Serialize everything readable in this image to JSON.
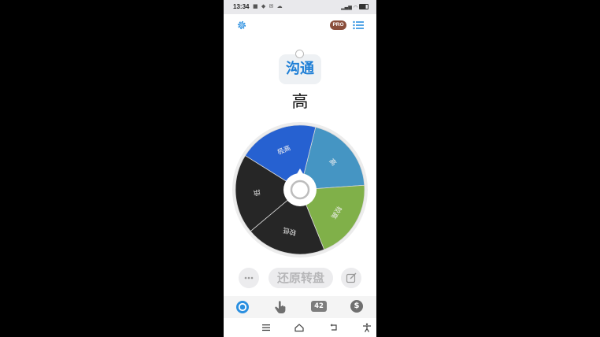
{
  "status_bar": {
    "time": "13:34",
    "notification_icons": [
      "video-icon",
      "message-icon",
      "mail-icon",
      "cloud-icon"
    ],
    "right_icons": [
      "network-speed-icon",
      "signal-icon",
      "wifi-icon",
      "battery-icon"
    ]
  },
  "header": {
    "settings_icon": "gear-icon",
    "pro_badge": "PRO",
    "list_icon": "list-icon"
  },
  "result": {
    "title": "沟通",
    "value": "高"
  },
  "wheel": {
    "segments": [
      {
        "label": "高",
        "color": "#4595c3"
      },
      {
        "label": "较高",
        "color": "#80b049"
      },
      {
        "label": "较低",
        "color": "#262626"
      },
      {
        "label": "低",
        "color": "#262626"
      },
      {
        "label": "极高",
        "color": "#2661d1"
      }
    ],
    "center_button": "spin-button"
  },
  "bottom_controls": {
    "more_icon": "more-icon",
    "reset_label": "还原转盘",
    "edit_icon": "edit-icon"
  },
  "tab_bar": {
    "tabs": [
      {
        "icon": "wheel-icon",
        "label": ""
      },
      {
        "icon": "tap-icon",
        "label": ""
      },
      {
        "icon": "number-icon",
        "label": "42"
      },
      {
        "icon": "dollar-icon",
        "label": "$"
      }
    ]
  },
  "nav_bar": {
    "icons": [
      "menu-icon",
      "home-icon",
      "back-icon",
      "accessibility-icon"
    ]
  }
}
